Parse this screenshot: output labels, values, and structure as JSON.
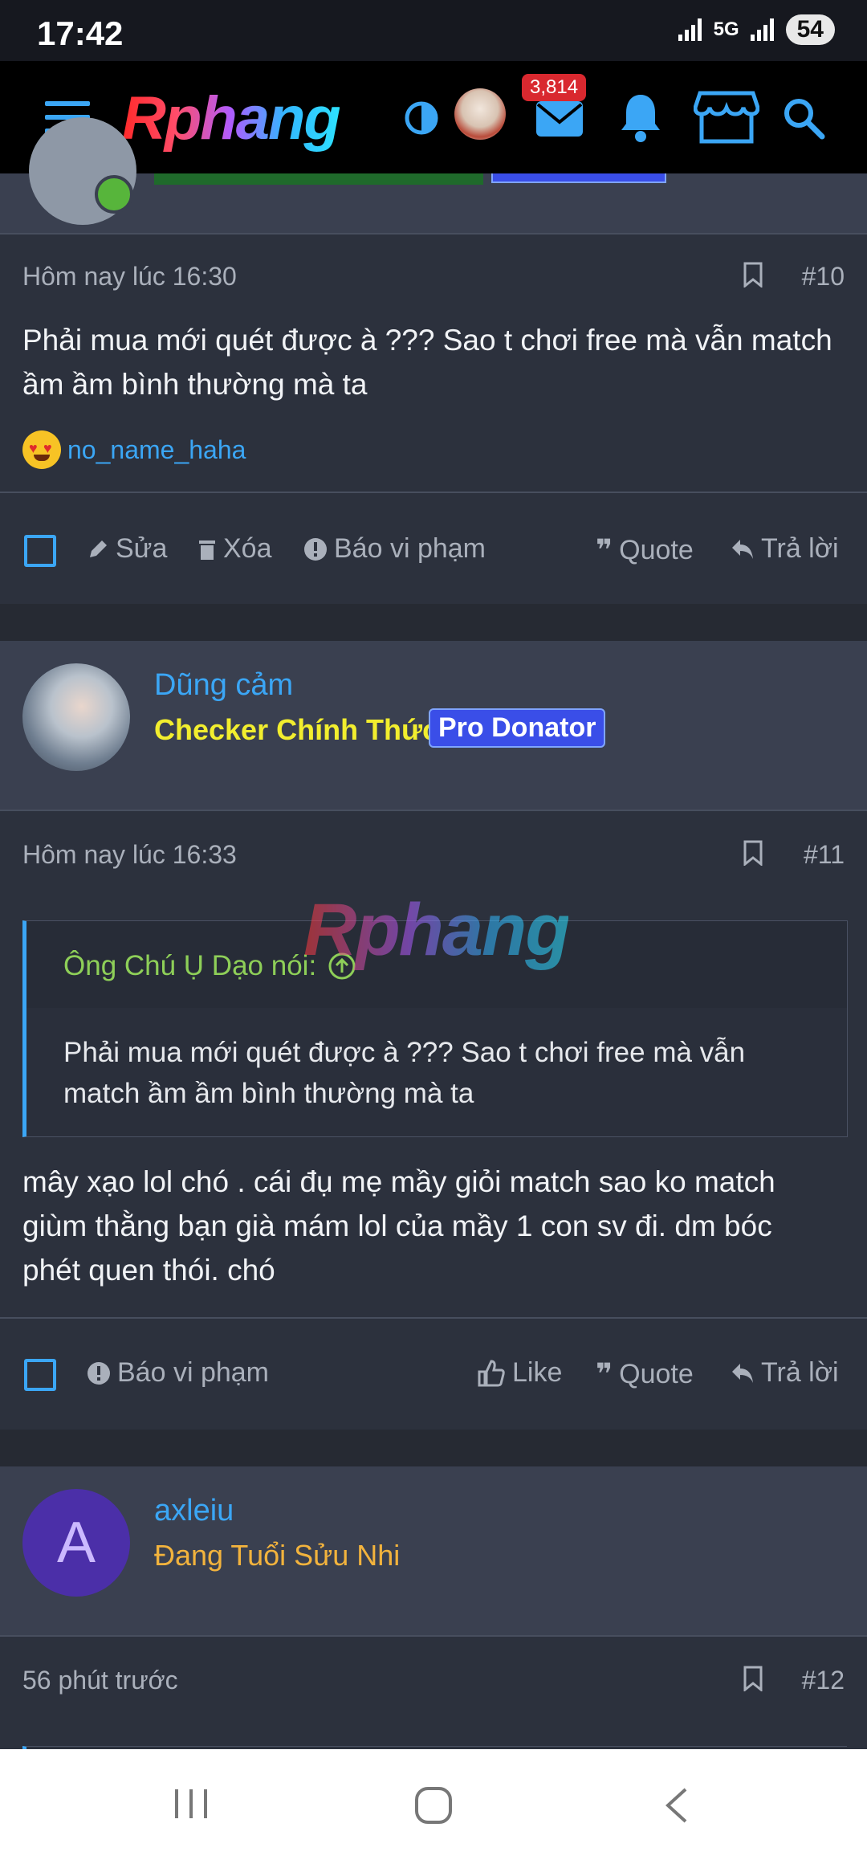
{
  "status_bar": {
    "time": "17:42",
    "network": "5G",
    "battery": "54"
  },
  "nav": {
    "logo": "Rphang",
    "inbox_count": "3,814"
  },
  "posts": [
    {
      "timestamp": "Hôm nay lúc 16:30",
      "number": "#10",
      "body": "Phải mua mới quét được à ??? Sao t chơi free mà vẫn match ầm ầm bình thường mà ta",
      "reaction_user": "no_name_haha",
      "actions": {
        "edit": "Sửa",
        "delete": "Xóa",
        "report": "Báo vi phạm",
        "quote": "Quote",
        "reply": "Trả lời"
      }
    },
    {
      "author": "Dũng cảm",
      "title": "Checker Chính Thức",
      "badge": "Pro Donator",
      "timestamp": "Hôm nay lúc 16:33",
      "number": "#11",
      "quote_author": "Ông Chú Ụ Dạo nói:",
      "quote_text": "Phải mua mới quét được à ??? Sao t chơi free mà vẫn match ầm ầm bình thường mà ta",
      "body": "mây xạo lol chó . cái đụ mẹ mầy giỏi match sao ko match giùm thằng bạn già mám lol của mầy 1 con sv đi. dm bóc phét quen thói. chó",
      "watermark": "Rphang",
      "actions": {
        "report": "Báo vi phạm",
        "like": "Like",
        "quote": "Quote",
        "reply": "Trả lời"
      }
    },
    {
      "author": "axleiu",
      "avatar_letter": "A",
      "title": "Đang Tuổi Sửu Nhi",
      "timestamp": "56 phút trước",
      "number": "#12"
    }
  ],
  "colors": {
    "link": "#3ba6f5",
    "checker_title": "#f2ee2e",
    "axleiu_title": "#f2b33d",
    "avatar_purple": "#4b2fa8"
  }
}
